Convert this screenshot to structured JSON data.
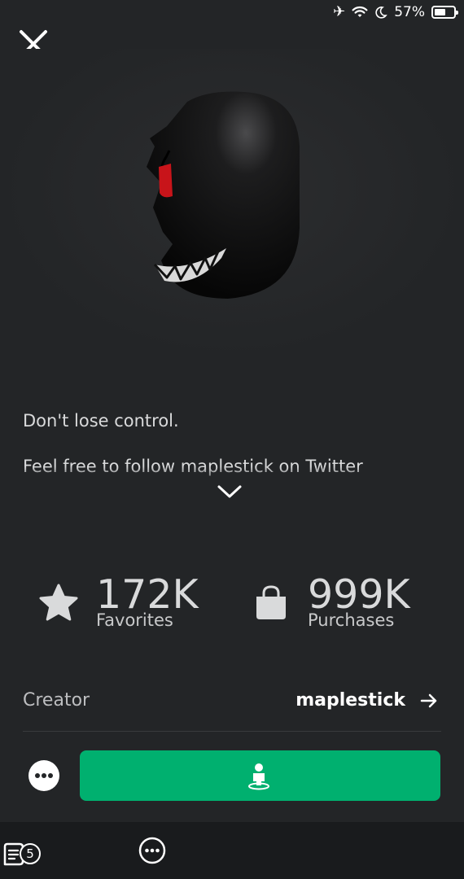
{
  "status_bar": {
    "battery_percent": "57%",
    "battery_level": 0.57,
    "icons": [
      "airplane-icon",
      "wifi-icon",
      "moon-icon",
      "battery-icon"
    ]
  },
  "item": {
    "image_description_icon": "black-hood-head-icon",
    "description_lines": [
      "Don't lose control.",
      "Feel free to follow maplestick on Twitter"
    ]
  },
  "stats": {
    "favorites_value": "172K",
    "favorites_label": "Favorites",
    "purchases_value": "999K",
    "purchases_label": "Purchases"
  },
  "creator": {
    "label": "Creator",
    "name": "maplestick"
  },
  "bottom_nav": {
    "chat_badge_count": "5"
  },
  "colors": {
    "background": "#232527",
    "accent_green": "#00b06f",
    "text_primary": "#ffffff",
    "text_secondary": "#d9dadb"
  }
}
